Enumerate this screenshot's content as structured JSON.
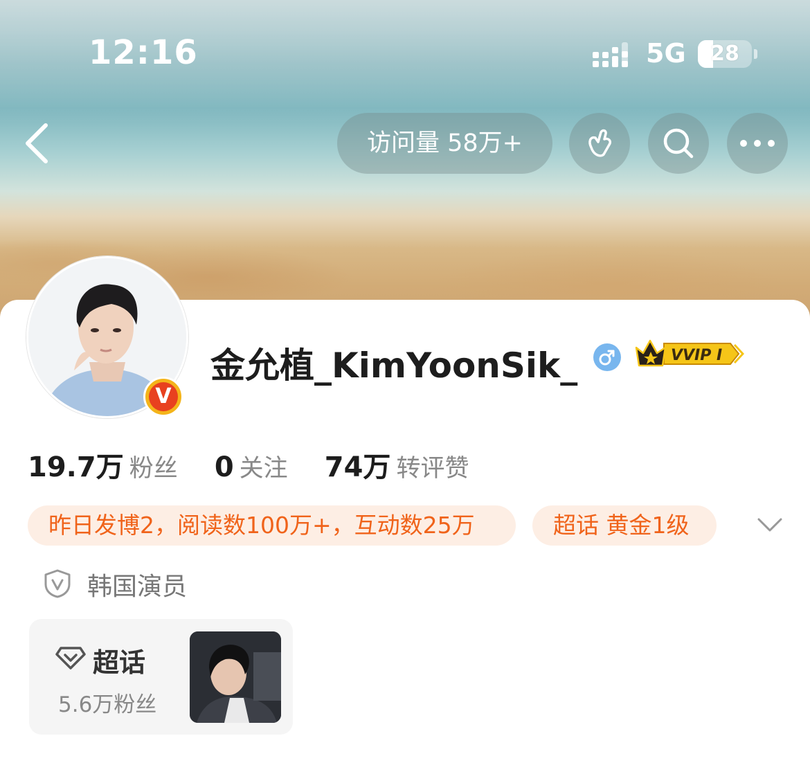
{
  "status_bar": {
    "time": "12:16",
    "network": "5G",
    "battery": "28",
    "battery_level": 0.28
  },
  "header": {
    "visits_label": "访问量 58万+"
  },
  "profile": {
    "username": "金允植_KimYoonSik_",
    "gender_icon": "male-icon",
    "vip_label": "VVIP I",
    "verified_icon": "verified-v-icon"
  },
  "stats": [
    {
      "value": "19.7万",
      "label": "粉丝"
    },
    {
      "value": "0",
      "label": "关注"
    },
    {
      "value": "74万",
      "label": "转评赞"
    }
  ],
  "tags": {
    "activity": "昨日发博2，阅读数100万+，互动数25万",
    "supertopic_level": "超话 黄金1级"
  },
  "role": "韩国演员",
  "supertopic_card": {
    "title": "超话",
    "fans": "5.6万粉丝"
  },
  "colors": {
    "accent_orange": "#f0631a",
    "tag_bg": "#fdeee4",
    "vip_gold": "#f5c518",
    "verified_red": "#e8411f",
    "male_blue": "#78b6ee"
  }
}
